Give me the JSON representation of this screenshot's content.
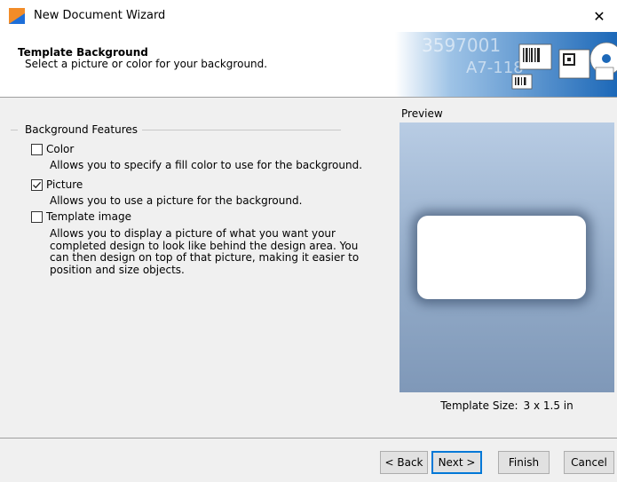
{
  "window": {
    "title": "New Document Wizard",
    "close_glyph": "✕"
  },
  "header": {
    "title": "Template Background",
    "subtitle": "Select a picture or color for your background.",
    "banner_codes": [
      "3597001",
      "A7-118"
    ]
  },
  "features": {
    "legend": "Background Features",
    "options": [
      {
        "label": "Color",
        "checked": false,
        "description": "Allows you to specify a fill color to use for the background."
      },
      {
        "label": "Picture",
        "checked": true,
        "description": "Allows you to use a picture for the background."
      },
      {
        "label": "Template image",
        "checked": false,
        "description": "Allows you to display a picture of what you want your completed design to look like behind the design area. You can then design on top of that picture, making it easier to position and size objects."
      }
    ]
  },
  "preview": {
    "label": "Preview",
    "template_size_label": "Template Size:",
    "template_size_value": "3 x 1.5 in"
  },
  "buttons": {
    "back": "< Back",
    "next": "Next >",
    "finish": "Finish",
    "cancel": "Cancel"
  },
  "colors": {
    "accent": "#0078d7",
    "icon_orange": "#f28c28",
    "icon_blue": "#1e6fd9"
  }
}
